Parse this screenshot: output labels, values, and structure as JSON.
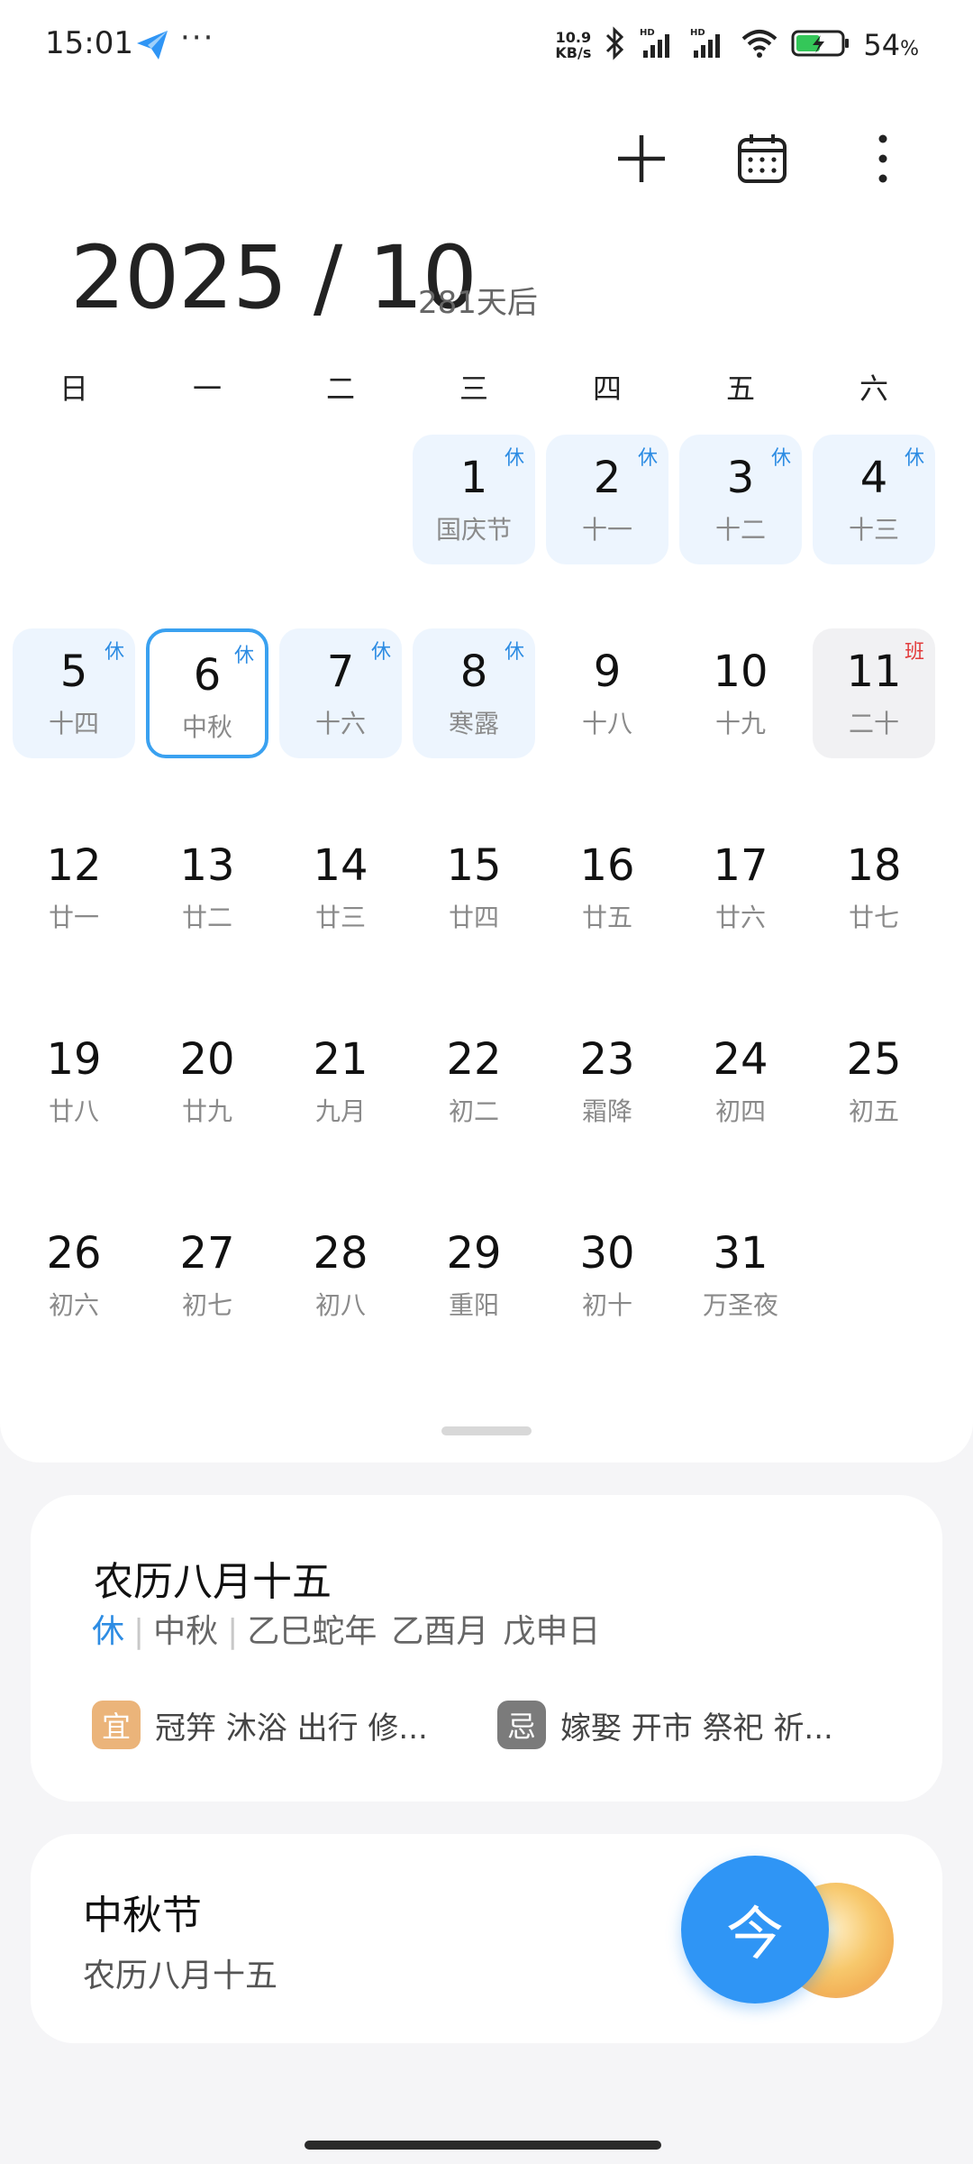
{
  "status_bar": {
    "time": "15:01",
    "more_dots": "···",
    "net_speed_value": "10.9",
    "net_speed_unit": "KB/s",
    "signal_label": "HD",
    "battery_percent": "54",
    "battery_unit": "%",
    "battery_level": 0.54
  },
  "header": {
    "month_title": "2025 / 10",
    "days_until": "281天后"
  },
  "weekdays": [
    "日",
    "一",
    "二",
    "三",
    "四",
    "五",
    "六"
  ],
  "days": [
    {
      "num": "1",
      "lunar": "国庆节",
      "badge": "休"
    },
    {
      "num": "2",
      "lunar": "十一",
      "badge": "休"
    },
    {
      "num": "3",
      "lunar": "十二",
      "badge": "休"
    },
    {
      "num": "4",
      "lunar": "十三",
      "badge": "休"
    },
    {
      "num": "5",
      "lunar": "十四",
      "badge": "休"
    },
    {
      "num": "6",
      "lunar": "中秋",
      "badge": "休"
    },
    {
      "num": "7",
      "lunar": "十六",
      "badge": "休"
    },
    {
      "num": "8",
      "lunar": "寒露",
      "badge": "休"
    },
    {
      "num": "9",
      "lunar": "十八",
      "badge": ""
    },
    {
      "num": "10",
      "lunar": "十九",
      "badge": ""
    },
    {
      "num": "11",
      "lunar": "二十",
      "badge": "班"
    },
    {
      "num": "12",
      "lunar": "廿一",
      "badge": ""
    },
    {
      "num": "13",
      "lunar": "廿二",
      "badge": ""
    },
    {
      "num": "14",
      "lunar": "廿三",
      "badge": ""
    },
    {
      "num": "15",
      "lunar": "廿四",
      "badge": ""
    },
    {
      "num": "16",
      "lunar": "廿五",
      "badge": ""
    },
    {
      "num": "17",
      "lunar": "廿六",
      "badge": ""
    },
    {
      "num": "18",
      "lunar": "廿七",
      "badge": ""
    },
    {
      "num": "19",
      "lunar": "廿八",
      "badge": ""
    },
    {
      "num": "20",
      "lunar": "廿九",
      "badge": ""
    },
    {
      "num": "21",
      "lunar": "九月",
      "badge": ""
    },
    {
      "num": "22",
      "lunar": "初二",
      "badge": ""
    },
    {
      "num": "23",
      "lunar": "霜降",
      "badge": ""
    },
    {
      "num": "24",
      "lunar": "初四",
      "badge": ""
    },
    {
      "num": "25",
      "lunar": "初五",
      "badge": ""
    },
    {
      "num": "26",
      "lunar": "初六",
      "badge": ""
    },
    {
      "num": "27",
      "lunar": "初七",
      "badge": ""
    },
    {
      "num": "28",
      "lunar": "初八",
      "badge": ""
    },
    {
      "num": "29",
      "lunar": "重阳",
      "badge": ""
    },
    {
      "num": "30",
      "lunar": "初十",
      "badge": ""
    },
    {
      "num": "31",
      "lunar": "万圣夜",
      "badge": ""
    }
  ],
  "selected_day": "6",
  "info_card": {
    "title": "农历八月十五",
    "rest_tag": "休",
    "festival": "中秋",
    "ganzhi_year": "乙巳蛇年",
    "ganzhi_month": "乙酉月",
    "ganzhi_day": "戊申日",
    "yi_label": "宜",
    "yi_text": "冠笄 沐浴 出行 修...",
    "ji_label": "忌",
    "ji_text": "嫁娶 开市 祭祀 祈..."
  },
  "festival_card": {
    "title": "中秋节",
    "subtitle": "农历八月十五"
  },
  "today_button": {
    "label": "今"
  },
  "colors": {
    "accent": "#2f95f5",
    "rest_badge": "#2d8ce3",
    "work_badge": "#e23c3c",
    "holiday_cell": "#edf5fe",
    "workday_cell": "#f1f1f3",
    "yi": "#ebb47a",
    "ji": "#7b7b7b"
  },
  "icons": {
    "add": "plus-icon",
    "calendar": "calendar-icon",
    "more": "more-vertical-icon"
  }
}
